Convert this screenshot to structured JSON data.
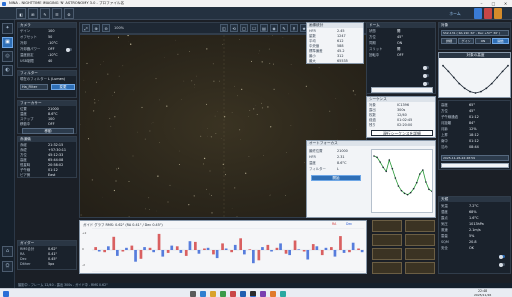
{
  "window": {
    "title": "NINA - NIGHTTIME IMAGING 'N' ASTRONOMY 3.0 - プロファイル名",
    "min": "–",
    "max": "□",
    "close": "✕"
  },
  "toolbar": {
    "tools": [
      "◧",
      "⊞",
      "✎",
      "☰",
      "⚙"
    ],
    "right_status": "ホーム"
  },
  "sidebar": {
    "buttons": [
      "✦",
      "▣",
      "◎",
      "◐",
      "⌂",
      "⛭"
    ]
  },
  "left_panel": {
    "camera_header": "カメラ",
    "camera_rows": [
      {
        "k": "ゲイン",
        "v": "100"
      },
      {
        "k": "オフセット",
        "v": "50"
      },
      {
        "k": "冷却",
        "v": "-10°C"
      },
      {
        "k": "冷却器パワー",
        "v": "OFF"
      },
      {
        "k": "温度設定",
        "v": "-10°C"
      },
      {
        "k": "USB制限",
        "v": "40"
      }
    ],
    "filter_header": "フィルター",
    "filter_label": "現在のフィルター",
    "filter_value": "L (Lumen)",
    "filter_select": "Ha_Filter",
    "filter_btn": "変更",
    "focuser_header": "フォーカサー",
    "focuser_rows": [
      {
        "k": "位置",
        "v": "21000"
      },
      {
        "k": "温度",
        "v": "8.6°C"
      },
      {
        "k": "ステップ",
        "v": "100"
      },
      {
        "k": "移動中",
        "v": "OFF"
      }
    ],
    "focuser_btn": "移動",
    "mount_header": "赤道儀",
    "mount_rows": [
      {
        "k": "赤経",
        "v": "21:32:15"
      },
      {
        "k": "赤緯",
        "v": "+57:30:11"
      },
      {
        "k": "方位",
        "v": "45:12:33"
      },
      {
        "k": "高度",
        "v": "65:44:08"
      },
      {
        "k": "恒星時",
        "v": "20:58:02"
      },
      {
        "k": "子午線",
        "v": "01:12"
      },
      {
        "k": "ピア側",
        "v": "East"
      }
    ],
    "guider_header": "ガイダー",
    "guider_rows": [
      {
        "k": "RMS合計",
        "v": "0.62\""
      },
      {
        "k": "RA",
        "v": "0.41\""
      },
      {
        "k": "Dec",
        "v": "0.45\""
      },
      {
        "k": "Dither",
        "v": "5px"
      }
    ]
  },
  "image_tools": [
    "⤢",
    "⊕",
    "⊖",
    "◫",
    "⟲",
    "□",
    "☐",
    "▤",
    "◈",
    "✎",
    "⚲",
    "★",
    "⬚",
    "⬒"
  ],
  "image_label": "100%",
  "chart": {
    "title": "ガイド グラフ  RMS: 0.62\" (RA 0.41\" / Dec 0.45\")",
    "legend_ra": "RA",
    "legend_dec": "Dec",
    "y_labels": [
      "+2",
      "0",
      "-2"
    ]
  },
  "center_right": {
    "hfr_header": "画像統計",
    "hfr_rows": [
      {
        "k": "HFR",
        "v": "2.45"
      },
      {
        "k": "星数",
        "v": "1247"
      },
      {
        "k": "平均",
        "v": "612"
      },
      {
        "k": "中央値",
        "v": "588"
      },
      {
        "k": "標準偏差",
        "v": "45.2"
      },
      {
        "k": "最小",
        "v": "312"
      },
      {
        "k": "最大",
        "v": "65535"
      }
    ],
    "seq_header": "シーケンス",
    "seq_rows": [
      {
        "k": "対象",
        "v": "IC1396"
      },
      {
        "k": "露出",
        "v": "300s"
      },
      {
        "k": "枚数",
        "v": "12/40"
      },
      {
        "k": "経過",
        "v": "01:02:45"
      },
      {
        "k": "残り",
        "v": "02:20:00"
      }
    ],
    "seq_btn": "現行シーケンスを詳細",
    "focus_header": "オートフォーカス",
    "focus_rows": [
      {
        "k": "最終位置",
        "v": "21000"
      },
      {
        "k": "HFR",
        "v": "2.31"
      },
      {
        "k": "温度",
        "v": "8.6°C"
      },
      {
        "k": "フィルター",
        "v": "L"
      }
    ],
    "focus_btn": "開始"
  },
  "dome_panel": {
    "header": "ドーム",
    "rows": [
      {
        "k": "状態",
        "v": "開"
      },
      {
        "k": "方位",
        "v": "45°"
      },
      {
        "k": "同期",
        "v": "ON"
      },
      {
        "k": "スリット",
        "v": "開"
      },
      {
        "k": "回転中",
        "v": "OFF"
      }
    ]
  },
  "right_panel": {
    "target_header": "対象",
    "target_name": "Sh2-131 ( RA 21h 32' , Dec +57° 30' )",
    "tabs": [
      "詳細",
      "ゲイン",
      "ON",
      "開始"
    ],
    "altitude_header": "対象の高度",
    "info_rows": [
      {
        "k": "高度",
        "v": "65°"
      },
      {
        "k": "方位",
        "v": "45°"
      },
      {
        "k": "子午線通過",
        "v": "01:12"
      },
      {
        "k": "月距離",
        "v": "84°"
      },
      {
        "k": "月齢",
        "v": "12%"
      },
      {
        "k": "上昇",
        "v": "18:12"
      },
      {
        "k": "南中",
        "v": "01:12"
      },
      {
        "k": "沈み",
        "v": "08:44"
      }
    ],
    "date_select": "2025-11-26-22:48:59",
    "weather_header": "天候",
    "weather_rows": [
      {
        "k": "気温",
        "v": "7.2°C"
      },
      {
        "k": "湿度",
        "v": "68%"
      },
      {
        "k": "露点",
        "v": "1.6°C"
      },
      {
        "k": "気圧",
        "v": "1013hPa"
      },
      {
        "k": "風速",
        "v": "2.1m/s"
      },
      {
        "k": "雲量",
        "v": "5%"
      },
      {
        "k": "SQM",
        "v": "20.8"
      },
      {
        "k": "安全",
        "v": "OK"
      }
    ]
  },
  "status": "撮影中 - フレーム 12/40 - 露出 300s - ガイド中 - RMS 0.62\"",
  "taskbar": {
    "clock": "22:48",
    "date": "2025/11/26"
  },
  "chart_data": {
    "type": "line",
    "title": "ガイド グラフ  RMS: 0.62\" (RA 0.41\" / Dec 0.45\")",
    "ylim": [
      -3,
      3
    ],
    "series": [
      {
        "name": "RA",
        "values": [
          0.4,
          -0.3,
          1.8,
          -0.2,
          0.6,
          -1.2,
          0.3,
          2.2,
          -0.4,
          0.5,
          -0.8,
          1.1,
          0.2,
          -0.6,
          0.9,
          -0.3,
          1.6,
          0.1,
          -1.4,
          0.7,
          0.3,
          -0.5,
          1.3,
          -0.2,
          0.8,
          -0.7,
          0.4,
          1.9,
          -0.3,
          0.2
        ]
      },
      {
        "name": "Dec",
        "values": [
          -0.2,
          0.5,
          -0.8,
          0.3,
          -1.6,
          0.4,
          -0.3,
          -0.9,
          0.6,
          -0.4,
          1.2,
          -0.5,
          0.3,
          -1.1,
          0.2,
          0.7,
          -0.6,
          -1.8,
          0.4,
          -0.2,
          0.9,
          -0.7,
          0.1,
          -1.3,
          0.5,
          0.3,
          -0.9,
          -0.4,
          1.0,
          -0.3
        ]
      }
    ]
  },
  "focus_curve": {
    "type": "line",
    "values": [
      8.1,
      7.9,
      7.2,
      6.4,
      5.8,
      7.5,
      6.2,
      4.8,
      3.6,
      2.9,
      2.5,
      2.3,
      2.6,
      3.2,
      4.1,
      5.4,
      6.0,
      4.2,
      3.1,
      2.8
    ]
  },
  "altitude_curve": {
    "type": "line",
    "values": [
      10,
      22,
      35,
      48,
      58,
      65,
      68,
      65,
      58,
      48,
      35,
      22,
      10
    ]
  }
}
